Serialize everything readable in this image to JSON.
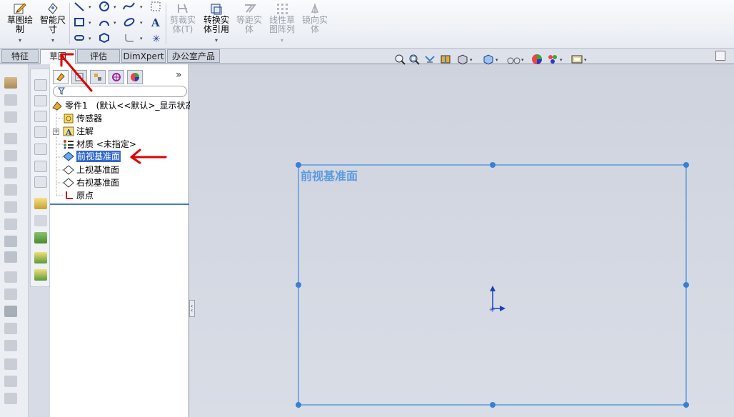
{
  "ribbon": {
    "sketch_label": "草图绘\n制",
    "smart_dim_label": "智能尺\n寸",
    "trim_label": "剪裁实\n体(T)",
    "convert_label": "转换实\n体引用",
    "offset_label": "等距实\n体",
    "pattern_label": "线性草\n图阵列",
    "mirror_label": "镜向实\n体"
  },
  "tabs": {
    "features": "特征",
    "sketch": "草图",
    "evaluate": "评估",
    "dimxpert": "DimXpert",
    "office": "办公室产品"
  },
  "tree": {
    "part": "零件1　(默认<<默认>_显示状态",
    "sensors": "传感器",
    "annotations": "注解",
    "material": "材质 <未指定>",
    "front_plane": "前视基准面",
    "top_plane": "上视基准面",
    "right_plane": "右视基准面",
    "origin": "原点"
  },
  "fm_more": "»",
  "graphics": {
    "plane_label": "前视基准面"
  },
  "colors": {
    "accent_blue": "#3a7fd6",
    "selection": "#3268c8",
    "annotation_red": "#e00000"
  }
}
